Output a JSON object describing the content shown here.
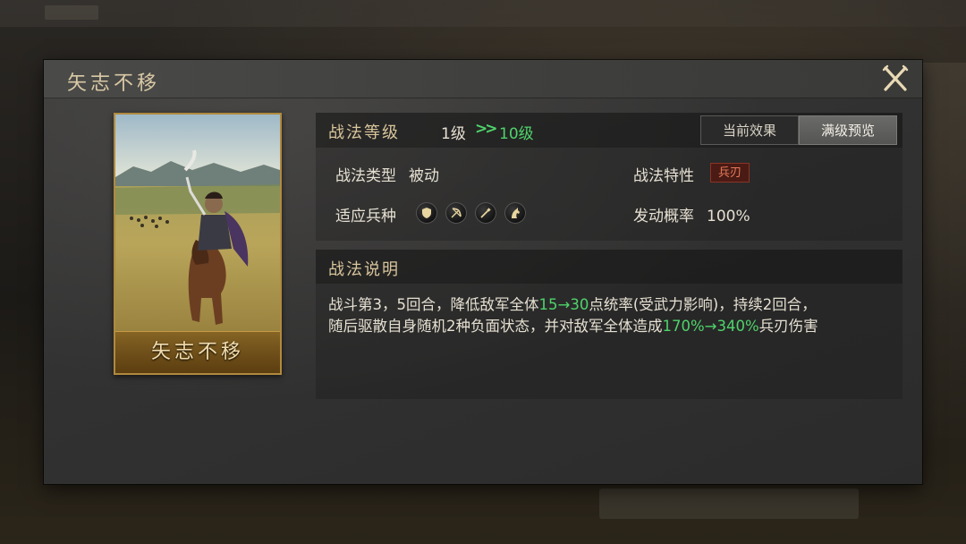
{
  "window": {
    "title": "矢志不移"
  },
  "card": {
    "name": "矢志不移"
  },
  "level": {
    "label": "战法等级",
    "current": "1级",
    "arrow": ">>",
    "max": "10级"
  },
  "tabs": [
    {
      "label": "当前效果",
      "active": false
    },
    {
      "label": "满级预览",
      "active": true
    }
  ],
  "attributes": {
    "type_label": "战法类型",
    "type_value": "被动",
    "trait_label": "战法特性",
    "trait_value": "兵刃",
    "troops_label": "适应兵种",
    "troops": [
      "shield-icon",
      "bow-icon",
      "spear-icon",
      "horse-icon"
    ],
    "rate_label": "发动概率",
    "rate_value": "100%"
  },
  "description": {
    "title": "战法说明",
    "line1_a": "战斗第3，5回合，降低敌军全体",
    "line1_hl": "15→30",
    "line1_b": "点统率(受武力影响)，持续2回合，",
    "line2_a": "随后驱散自身随机2种负面状态，并对敌军全体造成",
    "line2_hl": "170%→340%",
    "line2_b": "兵刃伤害"
  },
  "colors": {
    "accent_gold": "#d8c59b",
    "highlight_green": "#4fd36b",
    "trait_red": "#e87b5c",
    "card_border": "#b08a3e"
  }
}
